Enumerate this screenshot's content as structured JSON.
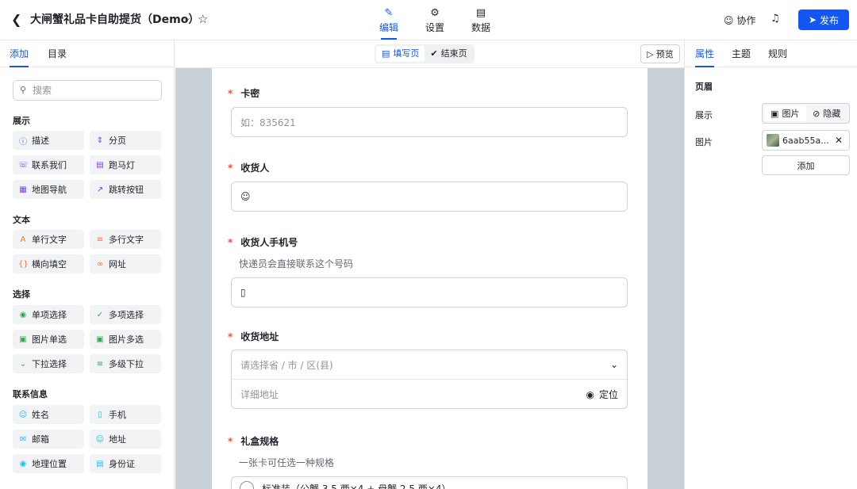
{
  "header": {
    "title": "大闸蟹礼品卡自助提货（Demo）",
    "nav": [
      {
        "label": "编辑",
        "icon": "pencil-icon"
      },
      {
        "label": "设置",
        "icon": "gear-icon"
      },
      {
        "label": "数据",
        "icon": "bar-chart-icon"
      }
    ],
    "collab_label": "协作",
    "publish_label": "发布"
  },
  "left": {
    "tabs": [
      "添加",
      "目录"
    ],
    "search_placeholder": "搜索",
    "groups": [
      {
        "title": "展示",
        "items": [
          "描述",
          "分页",
          "联系我们",
          "跑马灯",
          "地图导航",
          "跳转按钮"
        ]
      },
      {
        "title": "文本",
        "items": [
          "单行文字",
          "多行文字",
          "横向填空",
          "网址"
        ]
      },
      {
        "title": "选择",
        "items": [
          "单项选择",
          "多项选择",
          "图片单选",
          "图片多选",
          "下拉选择",
          "多级下拉"
        ]
      },
      {
        "title": "联系信息",
        "items": [
          "姓名",
          "手机",
          "邮箱",
          "地址",
          "地理位置",
          "身份证"
        ]
      }
    ]
  },
  "canvas": {
    "segments": [
      "填写页",
      "结束页"
    ],
    "preview_label": "预览",
    "questions": {
      "card": {
        "label": "卡密",
        "placeholder": "如：835621"
      },
      "receiver": {
        "label": "收货人"
      },
      "phone": {
        "label": "收货人手机号",
        "desc": "快递员会直接联系这个号码"
      },
      "address": {
        "label": "收货地址",
        "region_placeholder": "请选择省 / 市 / 区(县)",
        "detail_placeholder": "详细地址",
        "locate_label": "定位"
      },
      "spec": {
        "label": "礼盒规格",
        "desc": "一张卡可任选一种规格",
        "option1": "标准装（公蟹 3.5 两×4 + 母蟹 2.5 两×4）"
      }
    }
  },
  "right": {
    "tabs": [
      "属性",
      "主题",
      "规则"
    ],
    "section": "页眉",
    "display_label": "展示",
    "display_options": [
      "图片",
      "隐藏"
    ],
    "image_label": "图片",
    "image_name": "6aab55a...",
    "add_label": "添加"
  },
  "colors": {
    "accent": "#1456f0",
    "required": "#f54a45",
    "stage": "#c8d1d8"
  }
}
